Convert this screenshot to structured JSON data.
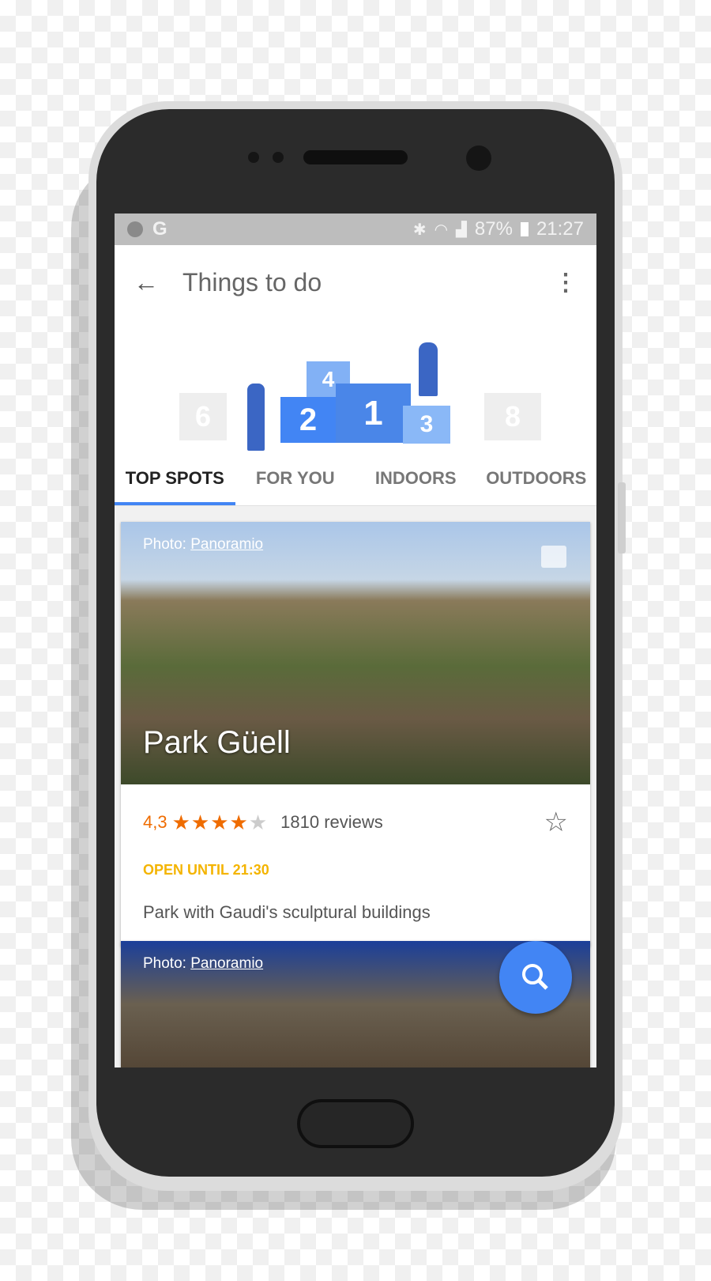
{
  "status_bar": {
    "battery": "87%",
    "time": "21:27",
    "left_icons": [
      "download-done-icon",
      "google-icon"
    ],
    "right_icons": [
      "bluetooth-icon",
      "wifi-icon",
      "signal-icon",
      "battery-charging-icon"
    ]
  },
  "app_bar": {
    "title": "Things to do",
    "back_icon": "arrow-back-icon",
    "menu_icon": "more-vert-icon"
  },
  "hero": {
    "podium_numbers": [
      "6",
      "4",
      "2",
      "1",
      "3",
      "8"
    ]
  },
  "tabs": [
    {
      "label": "TOP SPOTS",
      "active": true
    },
    {
      "label": "FOR YOU"
    },
    {
      "label": "INDOORS"
    },
    {
      "label": "OUTDOORS"
    }
  ],
  "cards": [
    {
      "credit_prefix": "Photo: ",
      "credit_link": "Panoramio",
      "title": "Park Güell",
      "rating": "4,3",
      "rating_value": 4.3,
      "stars": "★★★★★",
      "reviews": "1810 reviews",
      "open": "OPEN UNTIL 21:30",
      "description": "Park with Gaudi's sculptural buildings"
    },
    {
      "credit_prefix": "Photo: ",
      "credit_link": "Panoramio"
    }
  ],
  "colors": {
    "accent": "#4285f4",
    "rating": "#ef6c00",
    "open": "#f4b400"
  }
}
